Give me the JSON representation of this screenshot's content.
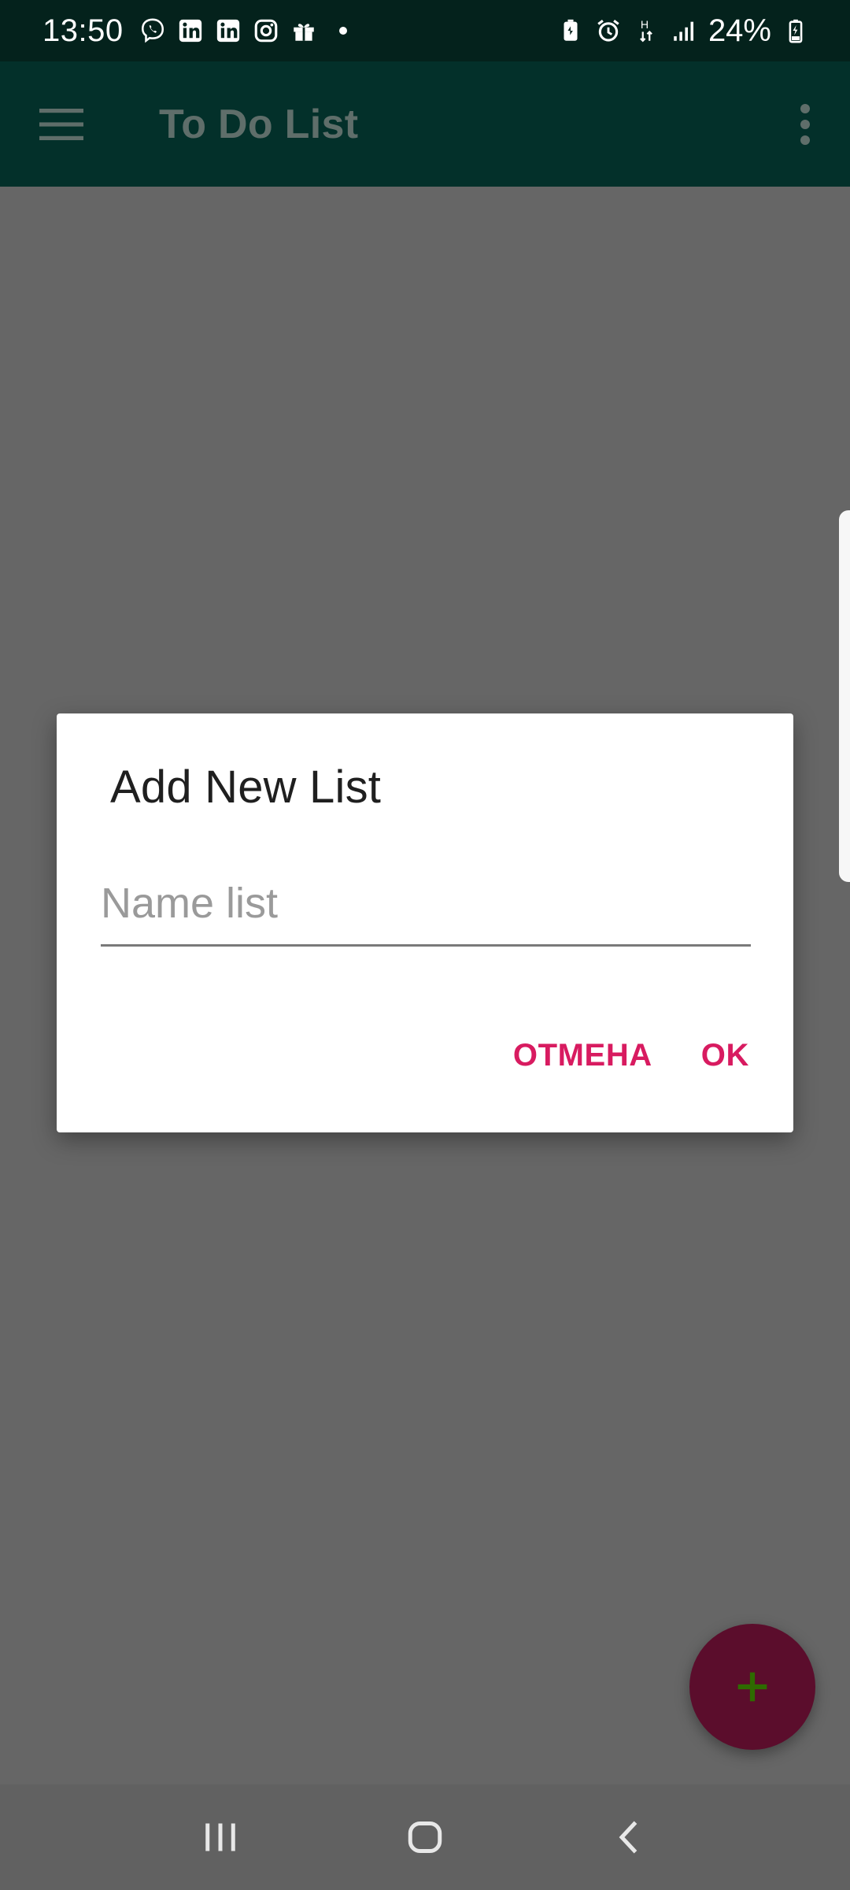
{
  "status_bar": {
    "time": "13:50",
    "left_icons": [
      "viber-icon",
      "linkedin-icon",
      "linkedin-icon",
      "instagram-icon",
      "gift-icon"
    ],
    "battery_text": "24%",
    "network_label": "H"
  },
  "app_bar": {
    "title": "To Do List"
  },
  "dialog": {
    "title": "Add New List",
    "input": {
      "placeholder": "Name list",
      "value": ""
    },
    "cancel_label": "ОТМЕНА",
    "ok_label": "OK"
  },
  "fab": {
    "icon": "plus-icon"
  },
  "colors": {
    "status_bar": "#04221C",
    "app_bar": "#03302A",
    "scrim_background": "#666666",
    "accent": "#D81B60",
    "fab": "#5B0D2C",
    "fab_icon": "#2E6B00"
  },
  "nav_bar": {
    "buttons": [
      "recent-apps-icon",
      "home-icon",
      "back-icon"
    ]
  }
}
